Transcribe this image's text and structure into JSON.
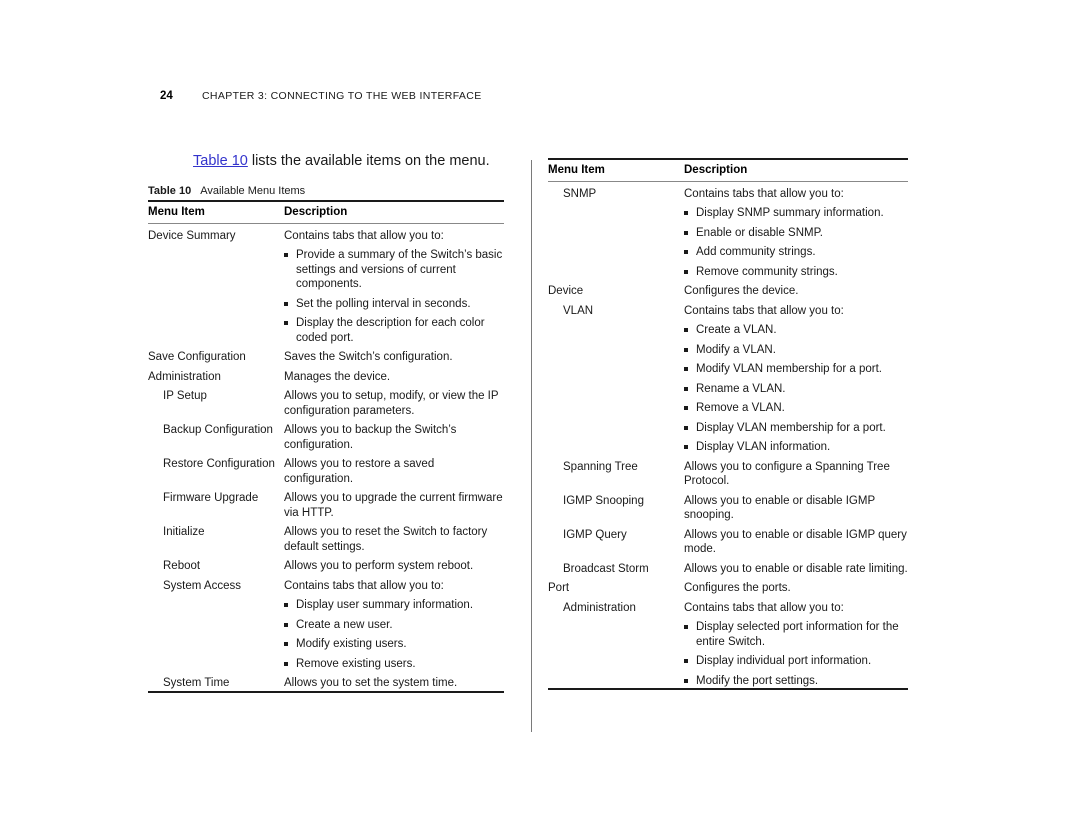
{
  "header": {
    "page_number": "24",
    "chapter_title": "CHAPTER 3: CONNECTING TO THE WEB INTERFACE"
  },
  "intro": {
    "link_text": "Table 10",
    "rest_text": " lists the available items on the menu."
  },
  "table_caption": {
    "label": "Table 10",
    "title": "Available Menu Items"
  },
  "columns": {
    "menu_item": "Menu Item",
    "description": "Description"
  },
  "left_table": {
    "rows": [
      {
        "item": "Device Summary",
        "level": 0,
        "lead": "Contains tabs that allow you to:",
        "bullets": [
          "Provide a summary of the Switch’s basic settings and versions of current components.",
          "Set the polling interval in seconds.",
          "Display the description for each color coded port."
        ]
      },
      {
        "item": "Save Configuration",
        "level": 0,
        "lead": "Saves the Switch’s configuration.",
        "bullets": []
      },
      {
        "item": "Administration",
        "level": 0,
        "lead": "Manages the device.",
        "bullets": []
      },
      {
        "item": "IP Setup",
        "level": 1,
        "lead": "Allows you to setup, modify, or view the IP configuration parameters.",
        "bullets": []
      },
      {
        "item": "Backup Configuration",
        "level": 1,
        "lead": "Allows you to backup the Switch’s configuration.",
        "bullets": []
      },
      {
        "item": "Restore Configuration",
        "level": 1,
        "lead": "Allows you to restore a saved configuration.",
        "bullets": []
      },
      {
        "item": "Firmware Upgrade",
        "level": 1,
        "lead": "Allows you to upgrade the current firmware via HTTP.",
        "bullets": []
      },
      {
        "item": "Initialize",
        "level": 1,
        "lead": "Allows you to reset the Switch to factory default settings.",
        "bullets": []
      },
      {
        "item": "Reboot",
        "level": 1,
        "lead": "Allows you to perform system reboot.",
        "bullets": []
      },
      {
        "item": "System Access",
        "level": 1,
        "lead": "Contains tabs that allow you to:",
        "bullets": [
          "Display user summary information.",
          "Create a new user.",
          "Modify existing users.",
          "Remove existing users."
        ]
      },
      {
        "item": "System Time",
        "level": 1,
        "lead": "Allows you to set the system time.",
        "bullets": []
      }
    ]
  },
  "right_table": {
    "rows": [
      {
        "item": "SNMP",
        "level": 1,
        "lead": "Contains tabs that allow you to:",
        "bullets": [
          "Display SNMP summary information.",
          "Enable or disable SNMP.",
          "Add community strings.",
          "Remove community strings."
        ]
      },
      {
        "item": "Device",
        "level": 0,
        "lead": "Configures the device.",
        "bullets": []
      },
      {
        "item": "VLAN",
        "level": 1,
        "lead": "Contains tabs that allow you to:",
        "bullets": [
          "Create a VLAN.",
          "Modify a VLAN.",
          "Modify VLAN membership for a port.",
          "Rename a VLAN.",
          "Remove a VLAN.",
          "Display VLAN membership for a port.",
          "Display VLAN information."
        ]
      },
      {
        "item": "Spanning Tree",
        "level": 1,
        "lead": "Allows you to configure a Spanning Tree Protocol.",
        "bullets": []
      },
      {
        "item": "IGMP Snooping",
        "level": 1,
        "lead": "Allows you to enable or disable IGMP snooping.",
        "bullets": []
      },
      {
        "item": "IGMP Query",
        "level": 1,
        "lead": "Allows you to enable or disable IGMP query mode.",
        "bullets": []
      },
      {
        "item": "Broadcast Storm",
        "level": 1,
        "lead": "Allows you to enable or disable rate limiting.",
        "bullets": []
      },
      {
        "item": "Port",
        "level": 0,
        "lead": "Configures the ports.",
        "bullets": []
      },
      {
        "item": "Administration",
        "level": 1,
        "lead": "Contains tabs that allow you to:",
        "bullets": [
          "Display selected port information for the entire Switch.",
          "Display individual port information.",
          "Modify the port settings."
        ]
      }
    ]
  }
}
